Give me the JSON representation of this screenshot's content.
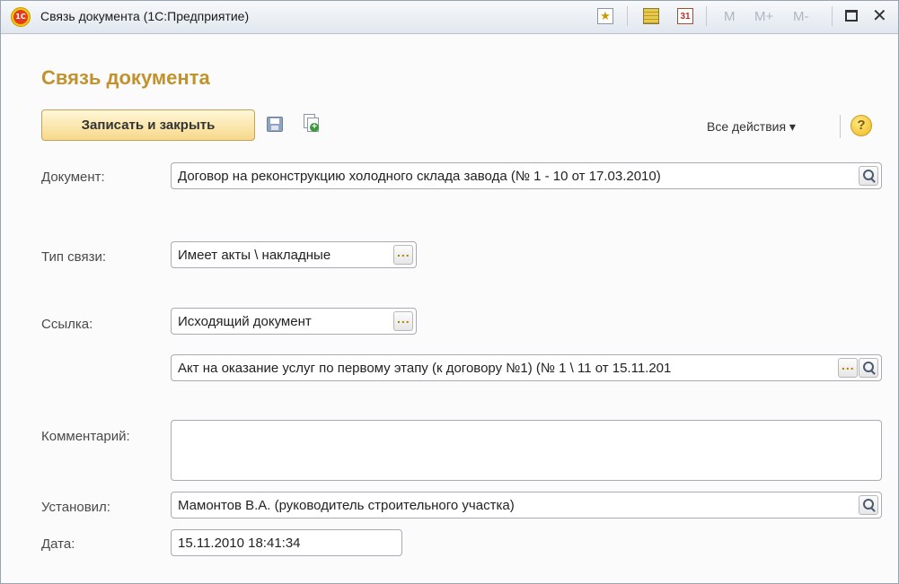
{
  "window": {
    "title": "Связь документа  (1С:Предприятие)",
    "logo_text": "1С",
    "toolbar": {
      "m": "M",
      "m_plus": "M+",
      "m_minus": "M-",
      "calendar_day": "31"
    }
  },
  "form": {
    "title": "Связь документа",
    "save_close_label": "Записать и закрыть",
    "all_actions_label": "Все действия ▾",
    "help_label": "?"
  },
  "fields": {
    "document": {
      "label": "Документ:",
      "value": "Договор на реконструкцию холодного склада завода (№ 1 - 10 от 17.03.2010)"
    },
    "link_type": {
      "label": "Тип связи:",
      "value": "Имеет акты \\ накладные"
    },
    "link": {
      "label": "Ссылка:",
      "type_value": "Исходящий документ",
      "value": "Акт на оказание услуг по первому этапу (к договору №1) (№ 1 \\ 11 от 15.11.201"
    },
    "comment": {
      "label": "Комментарий:",
      "value": ""
    },
    "installed_by": {
      "label": "Установил:",
      "value": "Мамонтов В.А. (руководитель строительного участка)"
    },
    "date": {
      "label": "Дата:",
      "value": "15.11.2010 18:41:34"
    }
  },
  "colors": {
    "title": "#c0932e",
    "main_button": "#f6d889",
    "border": "#a8acb2"
  }
}
